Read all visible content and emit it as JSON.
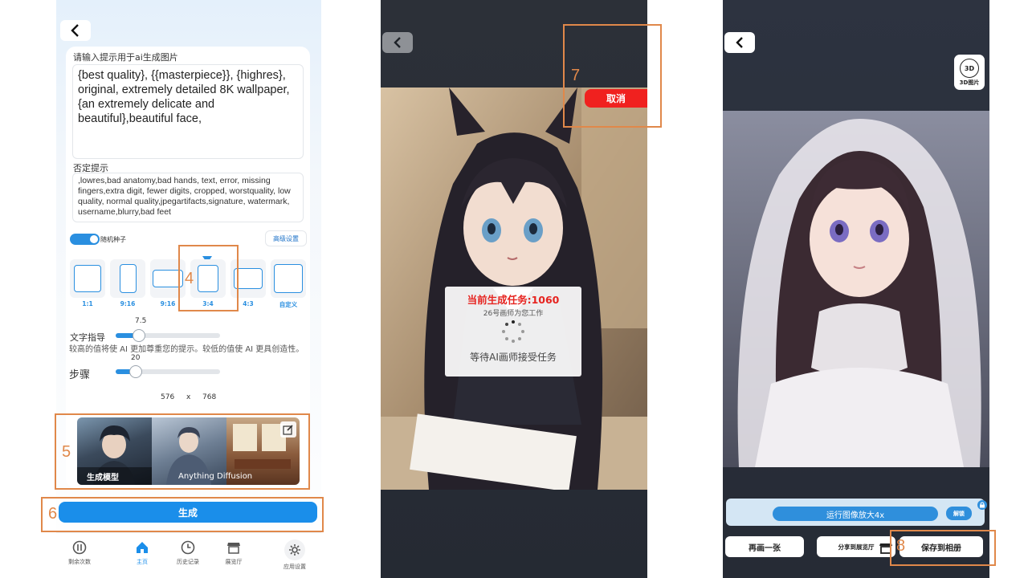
{
  "panel_generate": {
    "prompt_label": "请输入提示用于ai生成图片",
    "prompt_text": "{best quality}, {{masterpiece}}, {highres}, original, extremely detailed 8K wallpaper, {an extremely delicate and beautiful},beautiful face,",
    "negative_label": "否定提示",
    "negative_text": ",lowres,bad anatomy,bad hands, text, error, missing fingers,extra digit, fewer digits, cropped, worstquality, low quality, normal quality,jpegartifacts,signature, watermark, username,blurry,bad feet",
    "random_seed_label": "随机种子",
    "random_seed_enabled": true,
    "advanced_button": "高级设置",
    "ratios": [
      "1:1",
      "9:16",
      "9:16",
      "3:4",
      "4:3",
      "自定义"
    ],
    "selected_ratio": "3:4",
    "guidance_label": "文字指导",
    "guidance_value": "7.5",
    "guidance_fraction": 0.22,
    "guidance_description": "较高的值将使 AI 更加尊重您的提示。较低的值使 AI 更具创造性。",
    "steps_label": "步骤",
    "steps_value": "20",
    "steps_fraction": 0.19,
    "width": "576",
    "times": "x",
    "height": "768",
    "models": [
      {
        "label": "生成模型"
      },
      {
        "label": "Anything Diffusion"
      },
      {
        "label": ""
      }
    ],
    "generate_button": "生成",
    "nav": [
      {
        "label": "剩余次数",
        "icon": "coin-icon"
      },
      {
        "label": "主页",
        "icon": "home-icon"
      },
      {
        "label": "历史记录",
        "icon": "clock-icon"
      },
      {
        "label": "展览厅",
        "icon": "store-icon"
      },
      {
        "label": "应用设置",
        "icon": "gear-icon"
      }
    ]
  },
  "panel_waiting": {
    "cancel_button": "取消",
    "task_title": "当前生成任务:1060",
    "task_sub": "26号画师为您工作",
    "task_wait": "等待AI画师接受任务"
  },
  "panel_result": {
    "btn_3d_label": "3D图片",
    "btn_3d_glyph": "3D",
    "upscale_label": "运行图像放大4x",
    "unlock_button": "解锁",
    "redraw_button": "再画一张",
    "share_button": "分享到展览厅",
    "save_button": "保存到相册"
  },
  "annotations": [
    "4",
    "5",
    "6",
    "7",
    "8"
  ],
  "colors": {
    "accent": "#1a8eea",
    "annotation": "#e0884a",
    "cancel": "#f0211f"
  }
}
